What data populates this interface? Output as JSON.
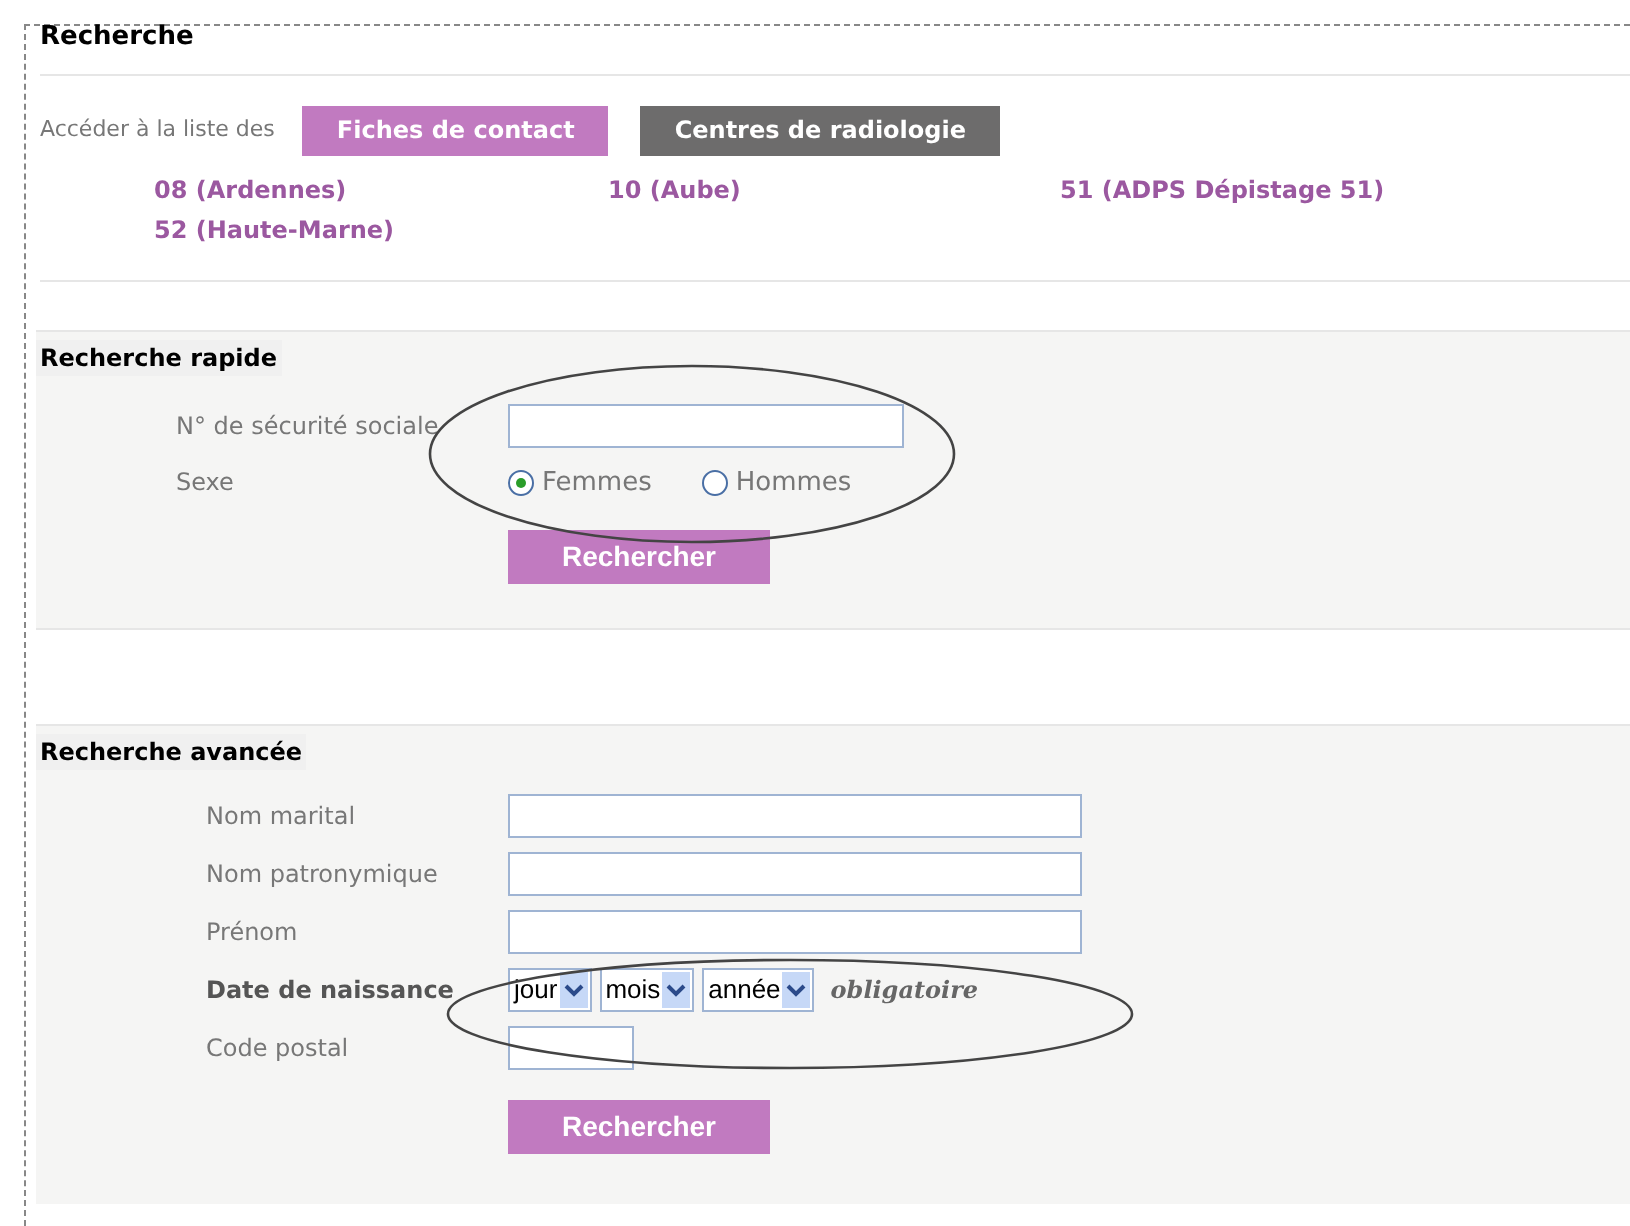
{
  "title": "Recherche",
  "access": {
    "label": "Accéder à la liste des",
    "buttons": [
      {
        "label": "Fiches de contact",
        "selected": true
      },
      {
        "label": "Centres de radiologie",
        "selected": false
      }
    ]
  },
  "departments": [
    "08 (Ardennes)",
    "10 (Aube)",
    "51 (ADPS Dépistage 51)",
    "52 (Haute-Marne)"
  ],
  "quick_search": {
    "title": "Recherche rapide",
    "ssn_label": "N° de sécurité sociale",
    "sex_label": "Sexe",
    "sex_options": [
      {
        "label": "Femmes",
        "selected": true
      },
      {
        "label": "Hommes",
        "selected": false
      }
    ],
    "button": "Rechercher"
  },
  "advanced_search": {
    "title": "Recherche avancée",
    "fields": [
      {
        "label": "Nom marital",
        "kind": "text"
      },
      {
        "label": "Nom patronymique",
        "kind": "text"
      },
      {
        "label": "Prénom",
        "kind": "text"
      },
      {
        "label": "Date de naissance",
        "kind": "date",
        "selects": [
          "jour",
          "mois",
          "année"
        ],
        "note": "obligatoire"
      },
      {
        "label": "Code postal",
        "kind": "short"
      }
    ],
    "button": "Rechercher"
  }
}
